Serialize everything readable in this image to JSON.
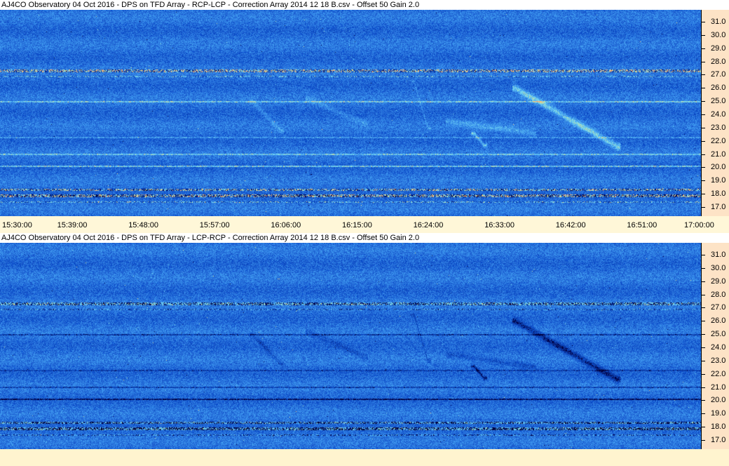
{
  "panels": [
    {
      "id": "top",
      "title": "AJ4CO Observatory 04 Oct 2016  -  DPS on TFD Array  -  RCP-LCP  -  Correction Array 2014 12 18 B.csv  -  Offset 50  Gain 2.0",
      "polarity": "bright",
      "show_time_labels": true
    },
    {
      "id": "bottom",
      "title": "AJ4CO Observatory 04 Oct 2016  -  DPS on TFD Array  -  LCP-RCP  -  Correction Array 2014 12 18 B.csv  -  Offset 50  Gain 2.0",
      "polarity": "dark",
      "show_time_labels": false
    }
  ],
  "freq_axis": {
    "unit_labels": [
      "31.0",
      "30.0",
      "29.0",
      "28.0",
      "27.0",
      "26.0",
      "25.0",
      "24.0",
      "23.0",
      "22.0",
      "21.0",
      "20.0",
      "19.0",
      "18.0",
      "17.0"
    ],
    "min": 16.5,
    "max": 31.8
  },
  "time_axis": {
    "labels": [
      "15:30:00",
      "15:39:00",
      "15:48:00",
      "15:57:00",
      "16:06:00",
      "16:15:00",
      "16:24:00",
      "16:33:00",
      "16:42:00",
      "16:51:00",
      "17:00:00"
    ]
  },
  "colors": {
    "base": "#2f6ad8",
    "freq_axis_bg": "#fde3c6",
    "time_axis_bg": "#fff7d8"
  }
}
